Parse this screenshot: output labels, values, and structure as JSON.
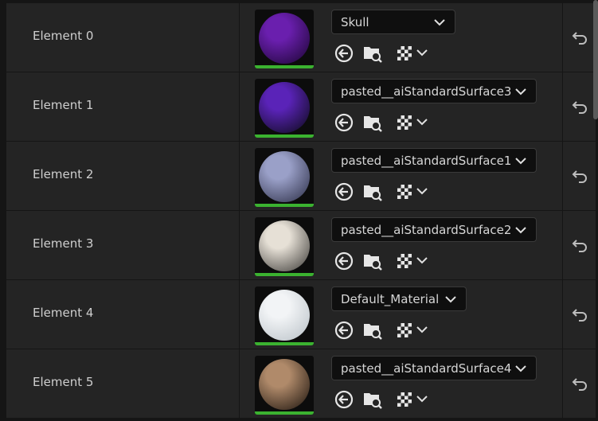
{
  "elements": [
    {
      "label": "Element 0",
      "material": "Skull",
      "sphere_colors": [
        "#6a1fae",
        "#1a0530"
      ]
    },
    {
      "label": "Element 1",
      "material": "pasted__aiStandardSurface3",
      "sphere_colors": [
        "#5a23b8",
        "#0a0a14"
      ]
    },
    {
      "label": "Element 2",
      "material": "pasted__aiStandardSurface1",
      "sphere_colors": [
        "#9aa0c8",
        "#2a2c44"
      ]
    },
    {
      "label": "Element 3",
      "material": "pasted__aiStandardSurface2",
      "sphere_colors": [
        "#e6e0d6",
        "#3a3835"
      ]
    },
    {
      "label": "Element 4",
      "material": "Default_Material",
      "sphere_colors": [
        "#f2f4f6",
        "#b8c0c6"
      ]
    },
    {
      "label": "Element 5",
      "material": "pasted__aiStandardSurface4",
      "sphere_colors": [
        "#b08a6a",
        "#1a120c"
      ]
    }
  ],
  "colors": {
    "accent_bar": "#3bb230",
    "row_bg": "#242424",
    "panel_bg": "#151515"
  },
  "icons": {
    "use_selected": "use-selected-asset-icon",
    "browse": "browse-to-asset-icon",
    "checker": "checkerboard-preview-icon",
    "reset": "reset-to-default-icon"
  }
}
